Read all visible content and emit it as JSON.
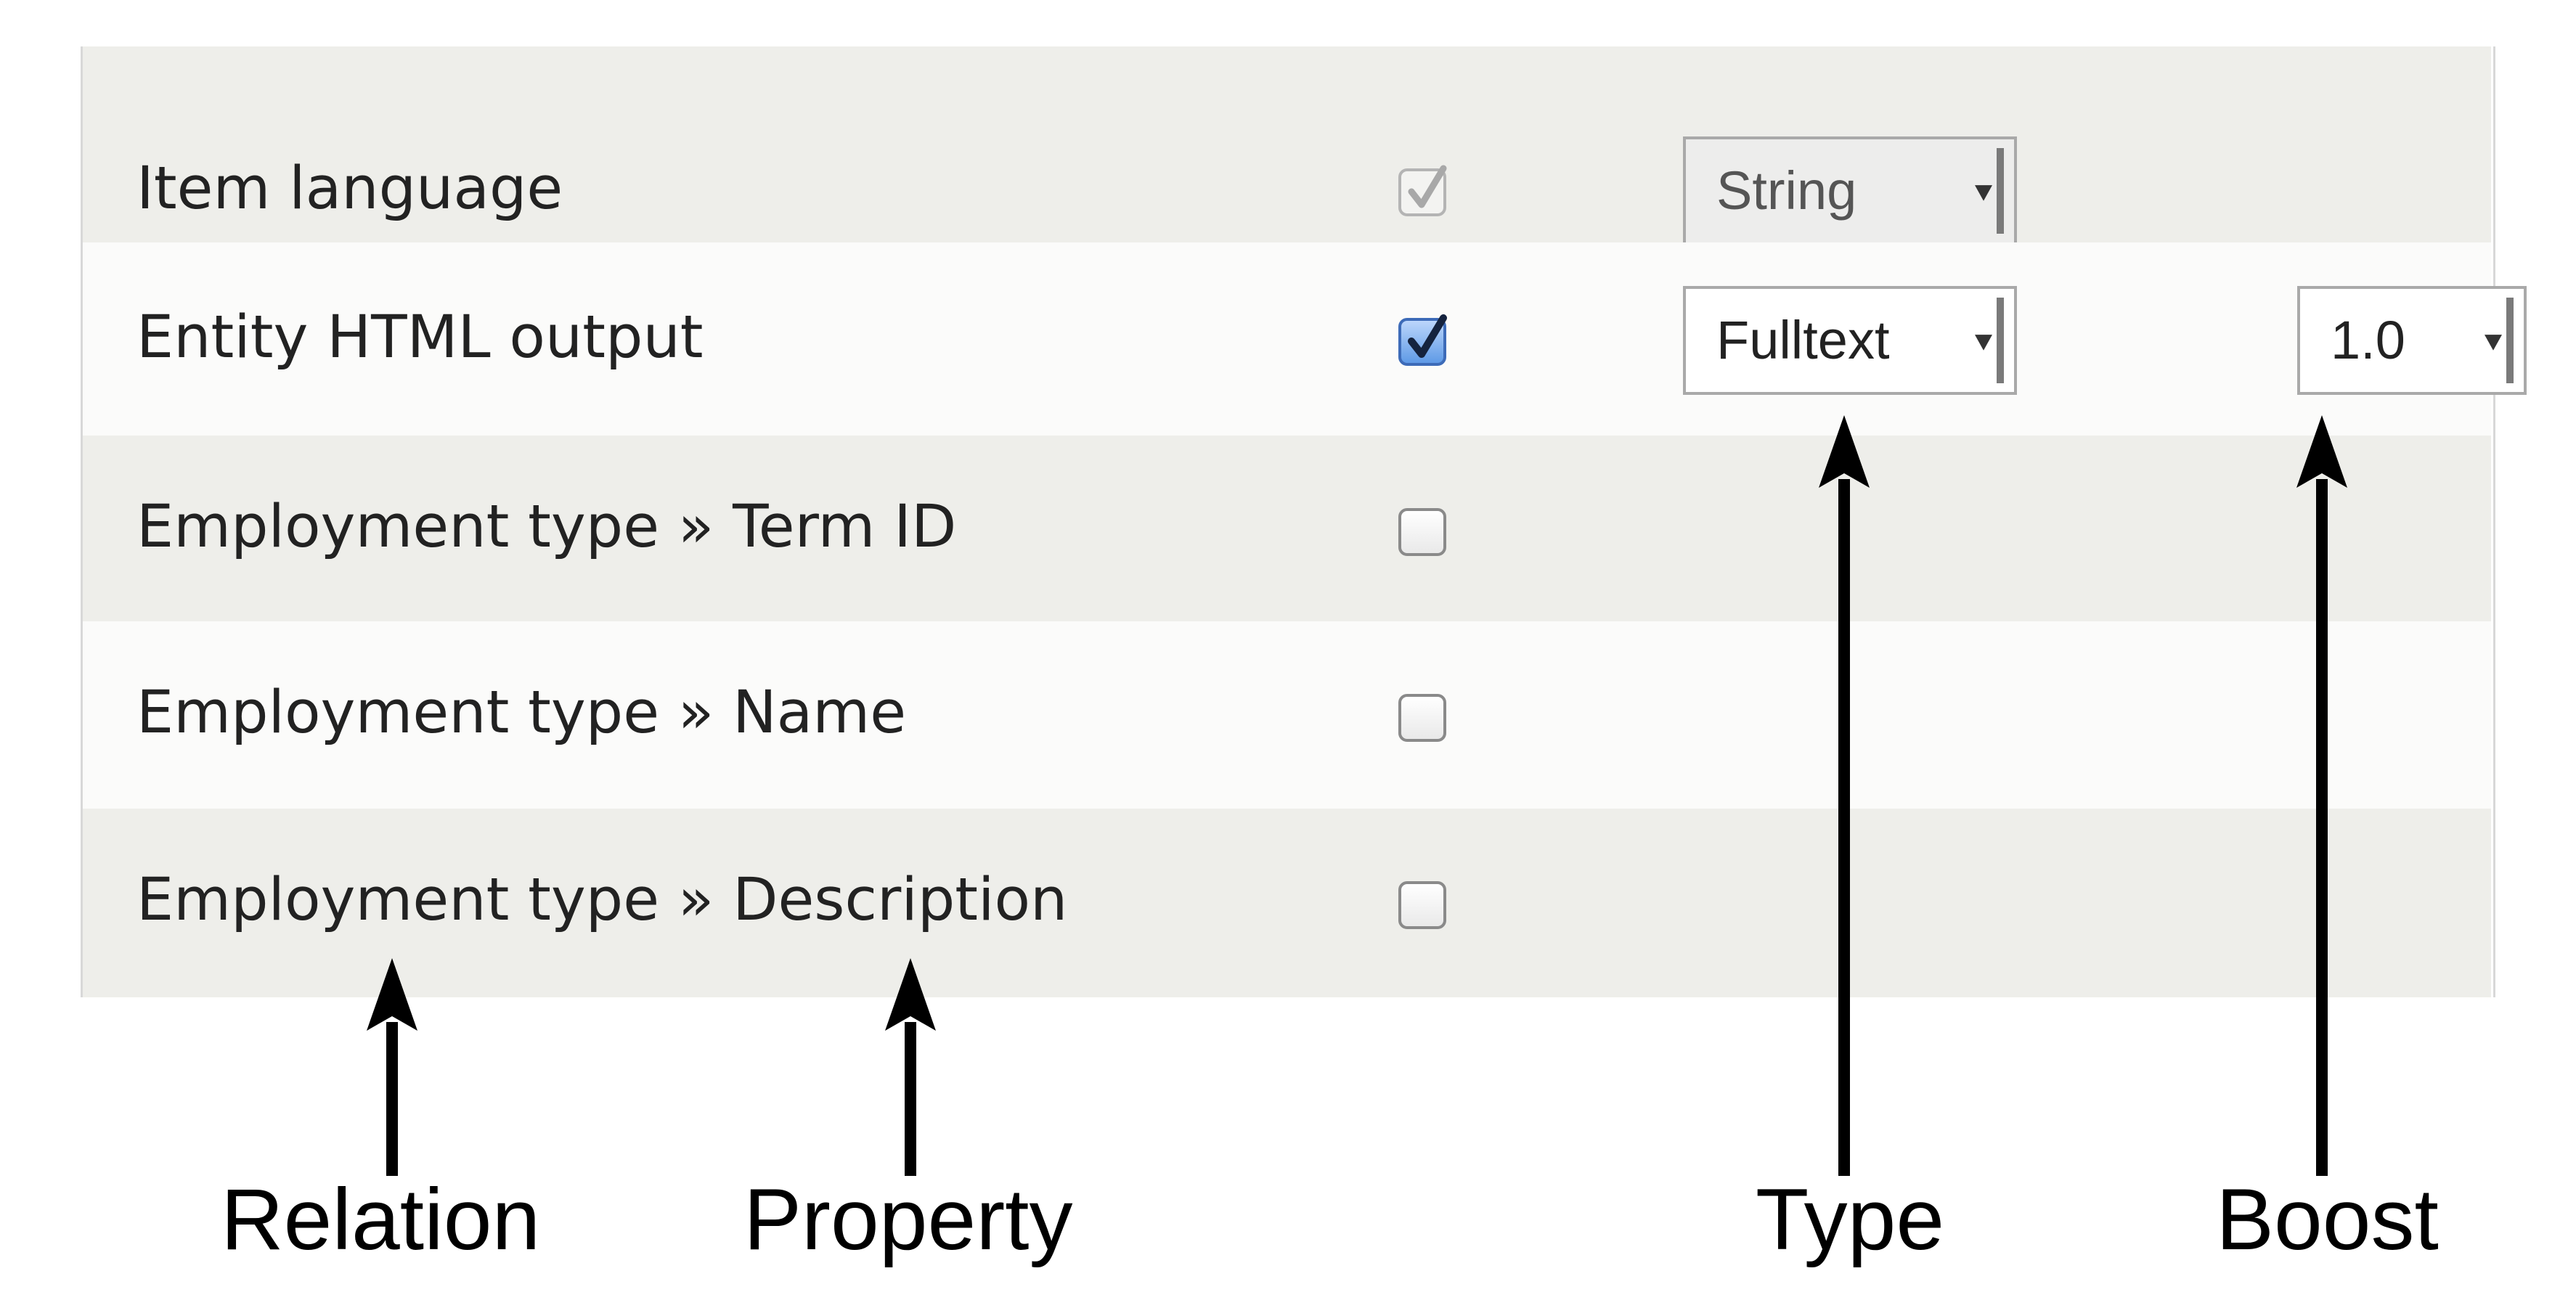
{
  "rows": [
    {
      "label": "Item language",
      "checkbox": "checked-disabled",
      "type": "String",
      "boost": ""
    },
    {
      "label": "Entity HTML output",
      "checkbox": "checked",
      "type": "Fulltext",
      "boost": "1.0"
    },
    {
      "label": "Employment type » Term ID",
      "checkbox": "unchecked",
      "type": "",
      "boost": ""
    },
    {
      "label": "Employment type » Name",
      "checkbox": "unchecked",
      "type": "",
      "boost": ""
    },
    {
      "label": "Employment type » Description",
      "checkbox": "unchecked",
      "type": "",
      "boost": ""
    }
  ],
  "annotations": {
    "relation": "Relation",
    "property": "Property",
    "type": "Type",
    "boost": "Boost"
  },
  "icons": {
    "checkmark": "checkmark-icon",
    "select_arrow": "dropdown-arrow-icon",
    "annotation_arrow": "arrow-up-icon"
  }
}
